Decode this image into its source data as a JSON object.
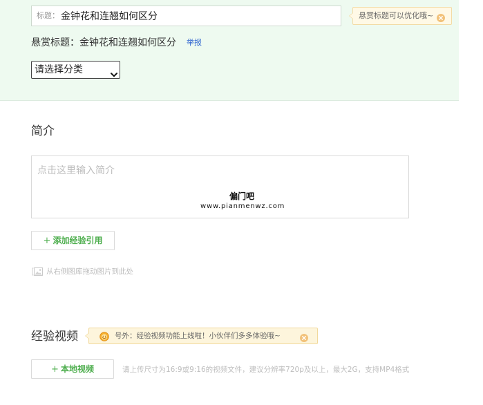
{
  "title_section": {
    "title_input": {
      "label": "标题：",
      "value": "金钟花和连翘如何区分"
    },
    "tip": {
      "text": "悬赏标题可以优化哦~",
      "close_icon": "close-circle-icon"
    },
    "reward_title": {
      "label": "悬赏标题：",
      "value": "金钟花和连翘如何区分",
      "report_link": "举报"
    },
    "category_select": {
      "selected": "请选择分类",
      "icon": "chevron-down-icon"
    }
  },
  "intro_section": {
    "heading": "简介",
    "textarea_placeholder": "点击这里输入简介",
    "watermark": {
      "line1": "偏门吧",
      "line2": "www.pianmenwz.com"
    },
    "add_reference_button": {
      "icon_glyph": "+",
      "label": "添加经验引用"
    },
    "image_drop_hint": {
      "icon": "image-icon",
      "text": "从右侧图库拖动图片到此处"
    }
  },
  "video_section": {
    "heading": "经验视频",
    "notice": {
      "icon": "smiley-icon",
      "text": "号外：经验视频功能上线啦！小伙伴们多多体验哦~",
      "close_icon": "close-circle-icon"
    },
    "local_video_button": {
      "icon_glyph": "+",
      "label": "本地视频"
    },
    "upload_hint": "请上传尺寸为16:9或9:16的视频文件，建议分辨率720p及以上，最大2G，支持MP4格式"
  },
  "colors": {
    "top_panel_bg": "#eefaf0",
    "accent_green": "#4eae4e",
    "link_blue": "#3066d0",
    "tip_bg": "#fff9e6",
    "tip_close": "#f2c27a",
    "notice_icon": "#f6b02e"
  }
}
